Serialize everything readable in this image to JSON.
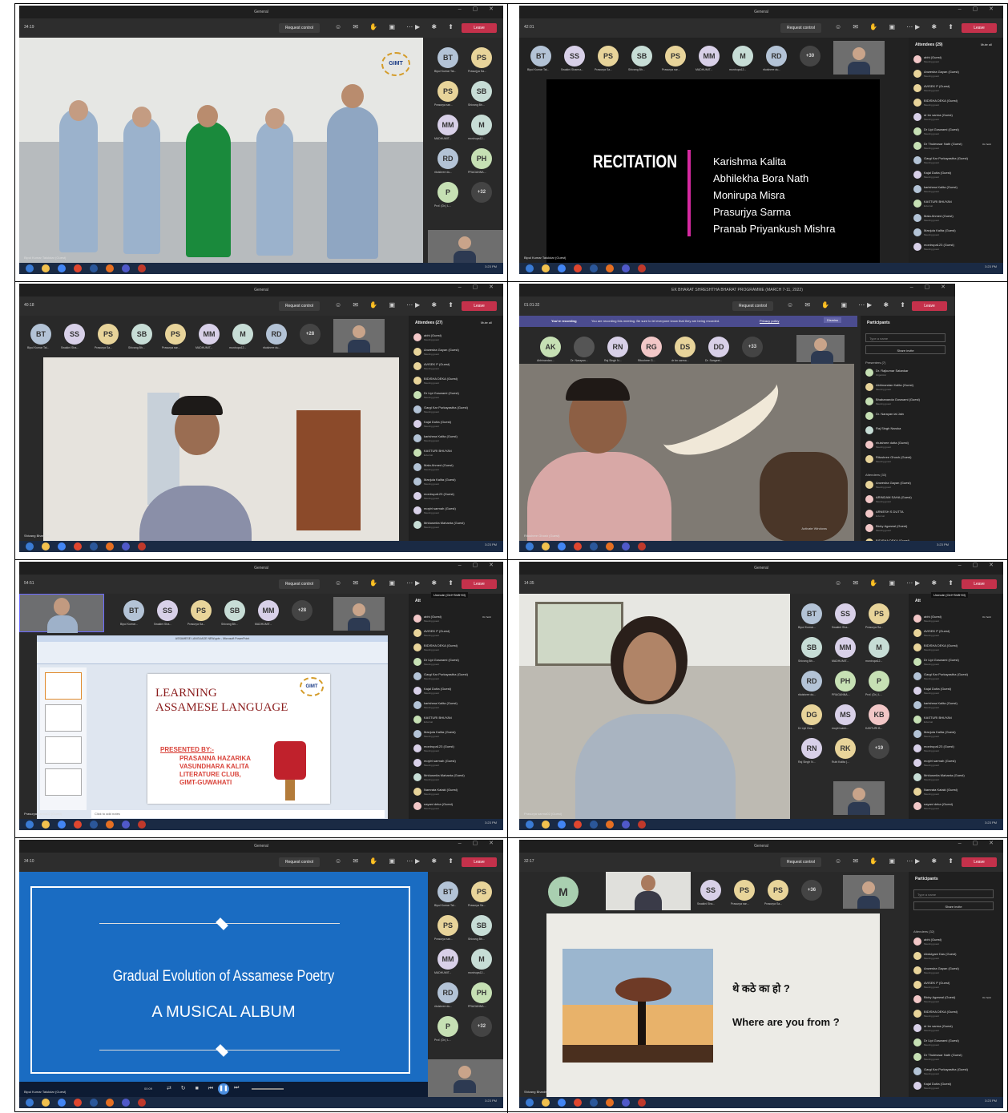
{
  "colors": {
    "teams_bg": "#292929",
    "leave": "#c4314b",
    "slide_blue": "#1a6cc2",
    "accent_pink": "#d62aa1"
  },
  "common": {
    "window_title": "General",
    "request_control": "Request control",
    "leave": "Leave",
    "taskbar_time": "3:23 PM"
  },
  "c1": {
    "timer": "34:19",
    "tiles": [
      {
        "i": "BT",
        "l": "Bipul Kumar Tal..."
      },
      {
        "i": "PS",
        "l": "Prasurjya Sa..."
      },
      {
        "i": "PS",
        "l": "Prasurya sar..."
      },
      {
        "i": "SB",
        "l": "Shivang Bh..."
      },
      {
        "i": "MM",
        "l": "MADHUMIT..."
      },
      {
        "i": "M",
        "l": "monirupa12..."
      },
      {
        "i": "RD",
        "l": "rituishree du..."
      },
      {
        "i": "PH",
        "l": "PRAGANNA..."
      },
      {
        "i": "P",
        "l": "Prof. (Dr.) L..."
      },
      {
        "i": "+32",
        "l": ""
      }
    ],
    "name": "Bipul Kumar Talukdar (Guest)",
    "logo": "GIMT"
  },
  "c2": {
    "timer": "42:01",
    "tiles": [
      {
        "i": "BT",
        "l": "Bipul Kumar Tal..."
      },
      {
        "i": "SS",
        "l": "Swakini Sharma..."
      },
      {
        "i": "PS",
        "l": "Prasurya Sa..."
      },
      {
        "i": "SB",
        "l": "Shivang Bh..."
      },
      {
        "i": "PS",
        "l": "Prasurya sar..."
      },
      {
        "i": "MM",
        "l": "MADHUMIT..."
      },
      {
        "i": "M",
        "l": "monirupa12..."
      },
      {
        "i": "RD",
        "l": "rituishree du..."
      },
      {
        "i": "+30",
        "l": ""
      }
    ],
    "slide_title": "RECITATION",
    "names": [
      "Karishma Kalita",
      "Abhilekha Bora Nath",
      "Monirupa Misra",
      "Prasurjya Sarma",
      "Pranab Priyankush Mishra"
    ],
    "panel_title": "Attendees (29)",
    "mute_all": "Mute all",
    "attendees": [
      {
        "n": "abhi (Guest)",
        "s": "Meeting guest"
      },
      {
        "n": "Anwesha Gayan (Guest)",
        "s": "Meeting guest"
      },
      {
        "n": "AVISEK P (Guest)",
        "s": "Meeting guest"
      },
      {
        "n": "BIDISHA DEKA (Guest)",
        "s": "Meeting guest"
      },
      {
        "n": "dr bn sarma (Guest)",
        "s": "Meeting guest"
      },
      {
        "n": "Dr Lipi Goswami (Guest)",
        "s": "Meeting guest"
      },
      {
        "n": "Dr Thuleswar Nath (Guest)",
        "s": "Meeting guest"
      },
      {
        "n": "Gargi Kar Purkayastha (Guest)",
        "s": "Meeting guest"
      },
      {
        "n": "Kajal Dutta (Guest)",
        "s": "Meeting guest"
      },
      {
        "n": "karishma Kalita (Guest)",
        "s": "Meeting guest"
      },
      {
        "n": "KASTURI BHUYAN",
        "s": "External"
      },
      {
        "n": "Mala Ahmed (Guest)",
        "s": "Meeting guest"
      },
      {
        "n": "Manjula Kalita (Guest)",
        "s": "Meeting guest"
      },
      {
        "n": "monirupa123 (Guest)",
        "s": "Meeting guest"
      }
    ],
    "on_hold": "On hold",
    "name": "Bipul Kumar Talukdar (Guest)"
  },
  "c3": {
    "timer": "40:18",
    "tiles": [
      {
        "i": "BT",
        "l": "Bipul Kumar Tal..."
      },
      {
        "i": "SS",
        "l": "Swakini Sha..."
      },
      {
        "i": "PS",
        "l": "Prasurya Sa..."
      },
      {
        "i": "SB",
        "l": "Shivang Bh..."
      },
      {
        "i": "PS",
        "l": "Prasurya sar..."
      },
      {
        "i": "MM",
        "l": "MADHUMIT..."
      },
      {
        "i": "M",
        "l": "monirupa12..."
      },
      {
        "i": "RD",
        "l": "rituishree du..."
      },
      {
        "i": "+28",
        "l": ""
      }
    ],
    "panel_title": "Attendees (27)",
    "mute_all": "Mute all",
    "attendees": [
      {
        "n": "abhi (Guest)",
        "s": "Meeting guest"
      },
      {
        "n": "Anwesha Gayan (Guest)",
        "s": "Meeting guest"
      },
      {
        "n": "AVISEK P (Guest)",
        "s": "Meeting guest"
      },
      {
        "n": "BIDISHA DEKA (Guest)",
        "s": "Meeting guest"
      },
      {
        "n": "Dr Lipi Goswami (Guest)",
        "s": "Meeting guest"
      },
      {
        "n": "Gargi Kar Purkayastha (Guest)",
        "s": "Meeting guest"
      },
      {
        "n": "Kajal Dutta (Guest)",
        "s": "Meeting guest"
      },
      {
        "n": "karishma Kalita (Guest)",
        "s": "Meeting guest"
      },
      {
        "n": "KASTURI BHUYAN",
        "s": "External"
      },
      {
        "n": "Mala Ahmed (Guest)",
        "s": "Meeting guest"
      },
      {
        "n": "Manjula Kalita (Guest)",
        "s": "Meeting guest"
      },
      {
        "n": "monirupa123 (Guest)",
        "s": "Meeting guest"
      },
      {
        "n": "moytri sarmah (Guest)",
        "s": "Meeting guest"
      },
      {
        "n": "Mridusmita Mahanta (Guest)",
        "s": "Meeting guest"
      }
    ],
    "name": "Shivang Bhardwaj"
  },
  "c4": {
    "window_title": "EK BHARAT SHRESHTHA BHARAT PROGRAMME (MARCH 7-11, 2022)",
    "timer": "01:01:32",
    "recording": "You're recording",
    "rec_msg": "You are recording this meeting. Be sure to let everyone know that they are being recorded.",
    "privacy": "Privacy policy",
    "dismiss": "Dismiss",
    "tiles": [
      {
        "i": "AK",
        "l": "Abhinandan..."
      },
      {
        "i": "",
        "l": "Dr. Narayan..."
      },
      {
        "i": "RN",
        "l": "Raj Singh N..."
      },
      {
        "i": "RG",
        "l": "Ritushree G..."
      },
      {
        "i": "DS",
        "l": "dr bn sarma..."
      },
      {
        "i": "DD",
        "l": "Dr. Sangeet..."
      },
      {
        "i": "+33",
        "l": ""
      }
    ],
    "panel_title": "Participants",
    "search": "Type a name",
    "share": "Share invite",
    "presenters": "Presenters (7)",
    "presenter_list": [
      {
        "n": "Dr. Rajkumar Satankar",
        "s": "Organizer"
      },
      {
        "n": "Abhinandan Kalita (Guest)",
        "s": "Meeting guest"
      },
      {
        "n": "Bhabananda Goswami (Guest)",
        "s": "Meeting guest"
      },
      {
        "n": "Dr. Narayan lal Jain",
        "s": ""
      },
      {
        "n": "Raj Singh Naruka",
        "s": ""
      },
      {
        "n": "rituishree dutta (Guest)",
        "s": "Meeting guest"
      },
      {
        "n": "Ritushree Ghosh (Guest)",
        "s": "Meeting guest"
      }
    ],
    "attendees_h": "Attendees (33)",
    "attendee_list": [
      {
        "n": "Anwesha Gayan (Guest)",
        "s": "Meeting guest"
      },
      {
        "n": "ARINDAM SAHA (Guest)",
        "s": "Meeting guest"
      },
      {
        "n": "ARNESH S DUTTA",
        "s": "External"
      },
      {
        "n": "Bicky Agarwal (Guest)",
        "s": "Meeting guest"
      },
      {
        "n": "BIDISHA DEKA (Guest)",
        "s": ""
      }
    ],
    "name": "Ritushree Ghosh (Guest)",
    "activate": "Activate Windows"
  },
  "c5": {
    "timer": "54:51",
    "tiles": [
      {
        "i": "BT",
        "l": "Bipul Kumar..."
      },
      {
        "i": "SS",
        "l": "Swakini Sha..."
      },
      {
        "i": "PS",
        "l": "Prasurya Sa..."
      },
      {
        "i": "SB",
        "l": "Shivang Bh..."
      },
      {
        "i": "MM",
        "l": "MADHUMIT..."
      },
      {
        "i": "+28",
        "l": ""
      }
    ],
    "unmute": "Unmute (Ctrl+Shift+M)",
    "panel_short": "Att",
    "slide_line1": "LEARNING",
    "slide_line2": "ASSAMESE LANGUAGE",
    "presented_by": "PRESENTED BY:-",
    "presenters": [
      "PRASANNA HAZARIKA",
      "VASUNDHARA KALITA",
      "LITERATURE CLUB,",
      "GIMT-GUWAHATI"
    ],
    "ppt_title": "ASSAMESE LANGUAGE NEW.pptx - Microsoft PowerPoint",
    "notes": "Click to add notes",
    "attendees": [
      {
        "n": "abhi (Guest)",
        "s": "Meeting guest"
      },
      {
        "n": "AVISEK P (Guest)",
        "s": "Meeting guest"
      },
      {
        "n": "BIDISHA DEKA (Guest)",
        "s": "Meeting guest"
      },
      {
        "n": "Dr Lipi Goswami (Guest)",
        "s": "Meeting guest"
      },
      {
        "n": "Gargi Kar Purkayastha (Guest)",
        "s": "Meeting guest"
      },
      {
        "n": "Kajal Dutta (Guest)",
        "s": "Meeting guest"
      },
      {
        "n": "karishma Kalita (Guest)",
        "s": "Meeting guest"
      },
      {
        "n": "KASTURI BHUYAN",
        "s": "External"
      },
      {
        "n": "Manjula Kalita (Guest)",
        "s": "Meeting guest"
      },
      {
        "n": "monirupa123 (Guest)",
        "s": "Meeting guest"
      },
      {
        "n": "moytri sarmah (Guest)",
        "s": "Meeting guest"
      },
      {
        "n": "Mridusmita Mahanta (Guest)",
        "s": "Meeting guest"
      },
      {
        "n": "Namrata Kataki (Guest)",
        "s": "Meeting guest"
      },
      {
        "n": "nayani deka (Guest)",
        "s": "Meeting guest"
      }
    ],
    "on_hold": "On hold",
    "name": "Prasurya sarma02 (Guest)"
  },
  "c6": {
    "timer": "14:35",
    "tiles": [
      {
        "i": "BT",
        "l": "Bipul Kumar..."
      },
      {
        "i": "SS",
        "l": "Swakini Sha..."
      },
      {
        "i": "PS",
        "l": "Prasurya Sa..."
      },
      {
        "i": "SB",
        "l": "Shivang Bh..."
      },
      {
        "i": "MM",
        "l": "MADHUMIT..."
      },
      {
        "i": "M",
        "l": "monirupa12..."
      },
      {
        "i": "RD",
        "l": "rituishree du..."
      },
      {
        "i": "PH",
        "l": "PRAGANNA..."
      },
      {
        "i": "P",
        "l": "Prof. (Dr.) L..."
      },
      {
        "i": "DG",
        "l": "Dr Lipi Gos..."
      },
      {
        "i": "MS",
        "l": "moytri sarm..."
      },
      {
        "i": "KB",
        "l": "KASTURI B..."
      },
      {
        "i": "RN",
        "l": "Raj Singh N..."
      },
      {
        "i": "RK",
        "l": "Rubi Kalita (..."
      },
      {
        "i": "+19",
        "l": ""
      }
    ],
    "unmute": "Unmute (Ctrl+Shift+M)",
    "panel_short": "Att",
    "attendees": [
      {
        "n": "abhi (Guest)",
        "s": "Meeting guest"
      },
      {
        "n": "AVISEK P (Guest)",
        "s": "Meeting guest"
      },
      {
        "n": "BIDISHA DEKA (Guest)",
        "s": "Meeting guest"
      },
      {
        "n": "Dr Lipi Goswami (Guest)",
        "s": "Meeting guest"
      },
      {
        "n": "Gargi Kar Purkayastha (Guest)",
        "s": "Meeting guest"
      },
      {
        "n": "Kajal Dutta (Guest)",
        "s": "Meeting guest"
      },
      {
        "n": "karishma Kalita (Guest)",
        "s": "Meeting guest"
      },
      {
        "n": "KASTURI BHUYAN",
        "s": "External"
      },
      {
        "n": "Manjula Kalita (Guest)",
        "s": "Meeting guest"
      },
      {
        "n": "monirupa123 (Guest)",
        "s": "Meeting guest"
      },
      {
        "n": "moytri sarmah (Guest)",
        "s": "Meeting guest"
      },
      {
        "n": "Mridusmita Mahanta (Guest)",
        "s": "Meeting guest"
      },
      {
        "n": "Namrata Kataki (Guest)",
        "s": "Meeting guest"
      },
      {
        "n": "nayani deka (Guest)",
        "s": "Meeting guest"
      }
    ],
    "on_hold": "On hold",
    "name": "Prasurya sarma02 (Guest)"
  },
  "c7": {
    "timer": "34:10",
    "tiles": [
      {
        "i": "BT",
        "l": "Bipul Kumar Tal..."
      },
      {
        "i": "PS",
        "l": "Prasurya Sa..."
      },
      {
        "i": "PS",
        "l": "Prasurya sar..."
      },
      {
        "i": "SB",
        "l": "Shivang Bh..."
      },
      {
        "i": "MM",
        "l": "MADHUMIT..."
      },
      {
        "i": "M",
        "l": "monirupa12..."
      },
      {
        "i": "RD",
        "l": "rituishree du..."
      },
      {
        "i": "PH",
        "l": "PRAGANNA..."
      },
      {
        "i": "P",
        "l": "Prof. (Dr.) L..."
      },
      {
        "i": "+32",
        "l": ""
      }
    ],
    "slide_title": "Gradual Evolution of Assamese Poetry",
    "slide_sub": "A MUSICAL ALBUM",
    "media_time": "00:09",
    "name": "Bipul Kumar Talukdar (Guest)"
  },
  "c8": {
    "timer": "32:17",
    "big_tile": "M",
    "tiles": [
      {
        "i": "SS",
        "l": "Swakini Sha..."
      },
      {
        "i": "PS",
        "l": "Prasurya sar..."
      },
      {
        "i": "PS",
        "l": "Prasurya Sa..."
      },
      {
        "i": "+36",
        "l": ""
      }
    ],
    "hindi": "थे कठे का हो ?",
    "english": "Where are you from ?",
    "panel_title": "Participants",
    "search": "Type a name",
    "share": "Share invite",
    "attendees_h": "Attendees (32)",
    "attendees": [
      {
        "n": "abhi (Guest)",
        "s": "Meeting guest"
      },
      {
        "n": "Abdulgani Das (Guest)",
        "s": "Meeting guest"
      },
      {
        "n": "Anwesha Gayan (Guest)",
        "s": "Meeting guest"
      },
      {
        "n": "AVISEK P (Guest)",
        "s": "Meeting guest"
      },
      {
        "n": "Bicky Agarwal (Guest)",
        "s": "Meeting guest"
      },
      {
        "n": "BIDISHA DEKA (Guest)",
        "s": "Meeting guest"
      },
      {
        "n": "dr bn sarma (Guest)",
        "s": "Meeting guest"
      },
      {
        "n": "Dr Lipi Goswami (Guest)",
        "s": "Meeting guest"
      },
      {
        "n": "Dr Thuleswar Nath (Guest)",
        "s": "Meeting guest"
      },
      {
        "n": "Gargi Kar Purkayastha (Guest)",
        "s": "Meeting guest"
      },
      {
        "n": "Kajal Dutta (Guest)",
        "s": "Meeting guest"
      }
    ],
    "on_hold": "On hold",
    "name": "Shivang Bhardwaj"
  }
}
